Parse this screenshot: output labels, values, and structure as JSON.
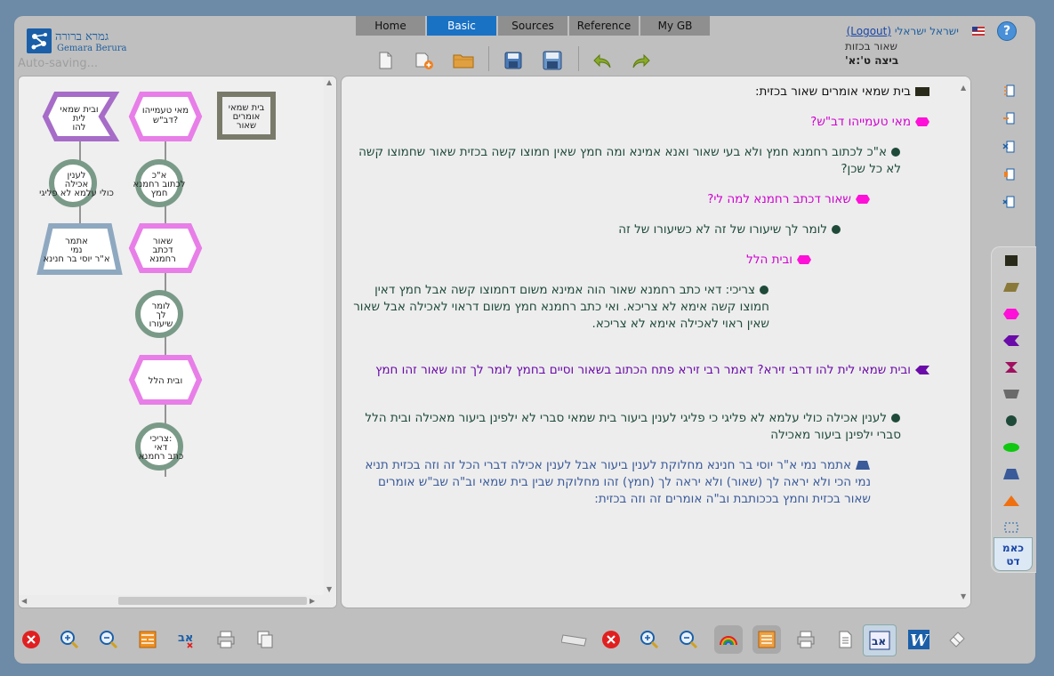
{
  "app": {
    "logo_he": "גמרא ברורה",
    "logo_en": "Gemara Berura",
    "autosave": "Auto-saving..."
  },
  "tabs": [
    {
      "label": "Home"
    },
    {
      "label": "Basic",
      "active": true
    },
    {
      "label": "Sources"
    },
    {
      "label": "Reference"
    },
    {
      "label": "My GB"
    }
  ],
  "user": {
    "name": "ישראל ישראלי",
    "logout": "(Logout)",
    "subtitle": "שאור בכזות",
    "location": "ביצה ט':א'"
  },
  "diagram": {
    "nodes": [
      {
        "id": "n1",
        "label_lines": [
          "בית שמאי",
          "אומרים",
          "שאור"
        ],
        "shape": "square",
        "color": "#7a7a6a"
      },
      {
        "id": "n2",
        "label_lines": [
          "מאי טעמייהו",
          "דב\"ש?"
        ],
        "shape": "hexagon",
        "color": "#e87ee8"
      },
      {
        "id": "n3",
        "label_lines": [
          "ובית שמאי",
          "לית",
          "להו"
        ],
        "shape": "arrow",
        "color": "#a66cc8"
      },
      {
        "id": "n4",
        "label_lines": [
          "א\"כ",
          "לכתוב רחמנא",
          "חמץ"
        ],
        "shape": "circle",
        "color": "#7a9a88"
      },
      {
        "id": "n5",
        "label_lines": [
          "לענין",
          "אכילה",
          "כולי עלמא לא פליגי"
        ],
        "shape": "circle",
        "color": "#7a9a88"
      },
      {
        "id": "n6",
        "label_lines": [
          "שאור",
          "דכתב",
          "רחמנא"
        ],
        "shape": "hexagon",
        "color": "#e87ee8"
      },
      {
        "id": "n7",
        "label_lines": [
          "אתמר",
          "נמי",
          "א\"ר יוסי בר חנינא"
        ],
        "shape": "trapezoid",
        "color": "#8ea8c0"
      },
      {
        "id": "n8",
        "label_lines": [
          "לומר",
          "לך",
          "שיעורו"
        ],
        "shape": "circle",
        "color": "#7a9a88"
      },
      {
        "id": "n9",
        "label_lines": [
          "ובית הלל"
        ],
        "shape": "hexagon",
        "color": "#e87ee8"
      },
      {
        "id": "n10",
        "label_lines": [
          "צריכי:",
          "דאי",
          "כתב רחמנא"
        ],
        "shape": "circle",
        "color": "#7a9a88"
      }
    ]
  },
  "entries": [
    {
      "bullet": "square",
      "color": "#111111",
      "text": "בית שמאי אומרים שאור בכזית:"
    },
    {
      "bullet": "hexagon",
      "color": "#d100d1",
      "text": "מאי טעמייהו דב\"ש?"
    },
    {
      "bullet": "circle",
      "color": "#1f4a3a",
      "text": "א\"כ לכתוב רחמנא חמץ ולא בעי שאור ואנא אמינא ומה חמץ שאין חמוצו קשה בכזית שאור שחמוצו קשה לא כל שכן?"
    },
    {
      "bullet": "hexagon",
      "color": "#d100d1",
      "text": "שאור דכתב רחמנא למה לי?"
    },
    {
      "bullet": "circle",
      "color": "#1f4a3a",
      "text": "לומר לך שיעורו של זה לא כשיעורו של זה"
    },
    {
      "bullet": "hexagon",
      "color": "#d100d1",
      "text": "ובית הלל"
    },
    {
      "bullet": "circle",
      "color": "#1f4a3a",
      "text": "צריכי: דאי כתב רחמנא שאור הוה אמינא משום דחמוצו קשה אבל חמץ דאין חמוצו קשה אימא לא צריכא. ואי כתב רחמנא חמץ משום דראוי לאכילה אבל שאור שאין ראוי לאכילה אימא לא צריכא."
    },
    {
      "bullet": "arrow",
      "color": "#6a0aa8",
      "text": "ובית שמאי לית להו דרבי זירא? דאמר רבי זירא פתח הכתוב בשאור וסיים בחמץ לומר לך זהו שאור זהו חמץ"
    },
    {
      "bullet": "circle",
      "color": "#1f4a3a",
      "text": "לענין אכילה כולי עלמא לא פליגי כי פליגי לענין ביעור בית שמאי סברי לא ילפינן ביעור מאכילה ובית הלל סברי ילפינן ביעור מאכילה"
    },
    {
      "bullet": "trapezoid",
      "color": "#3a5a9a",
      "text": "אתמר נמי א\"ר יוסי בר חנינא מחלוקת לענין ביעור אבל לענין אכילה דברי הכל זה וזה בכזית תניא נמי הכי ולא יראה לך (שאור) ולא יראה לך (חמץ) זהו מחלוקת שבין בית שמאי וב\"ה שב\"ש אומרים שאור בכזית וחמץ בככותבת וב\"ה אומרים זה וזה בכזית:"
    }
  ],
  "palette": {
    "label": "כאמ דט"
  },
  "colors": {
    "accent": "#1a72c4",
    "link": "#1a47a8"
  }
}
